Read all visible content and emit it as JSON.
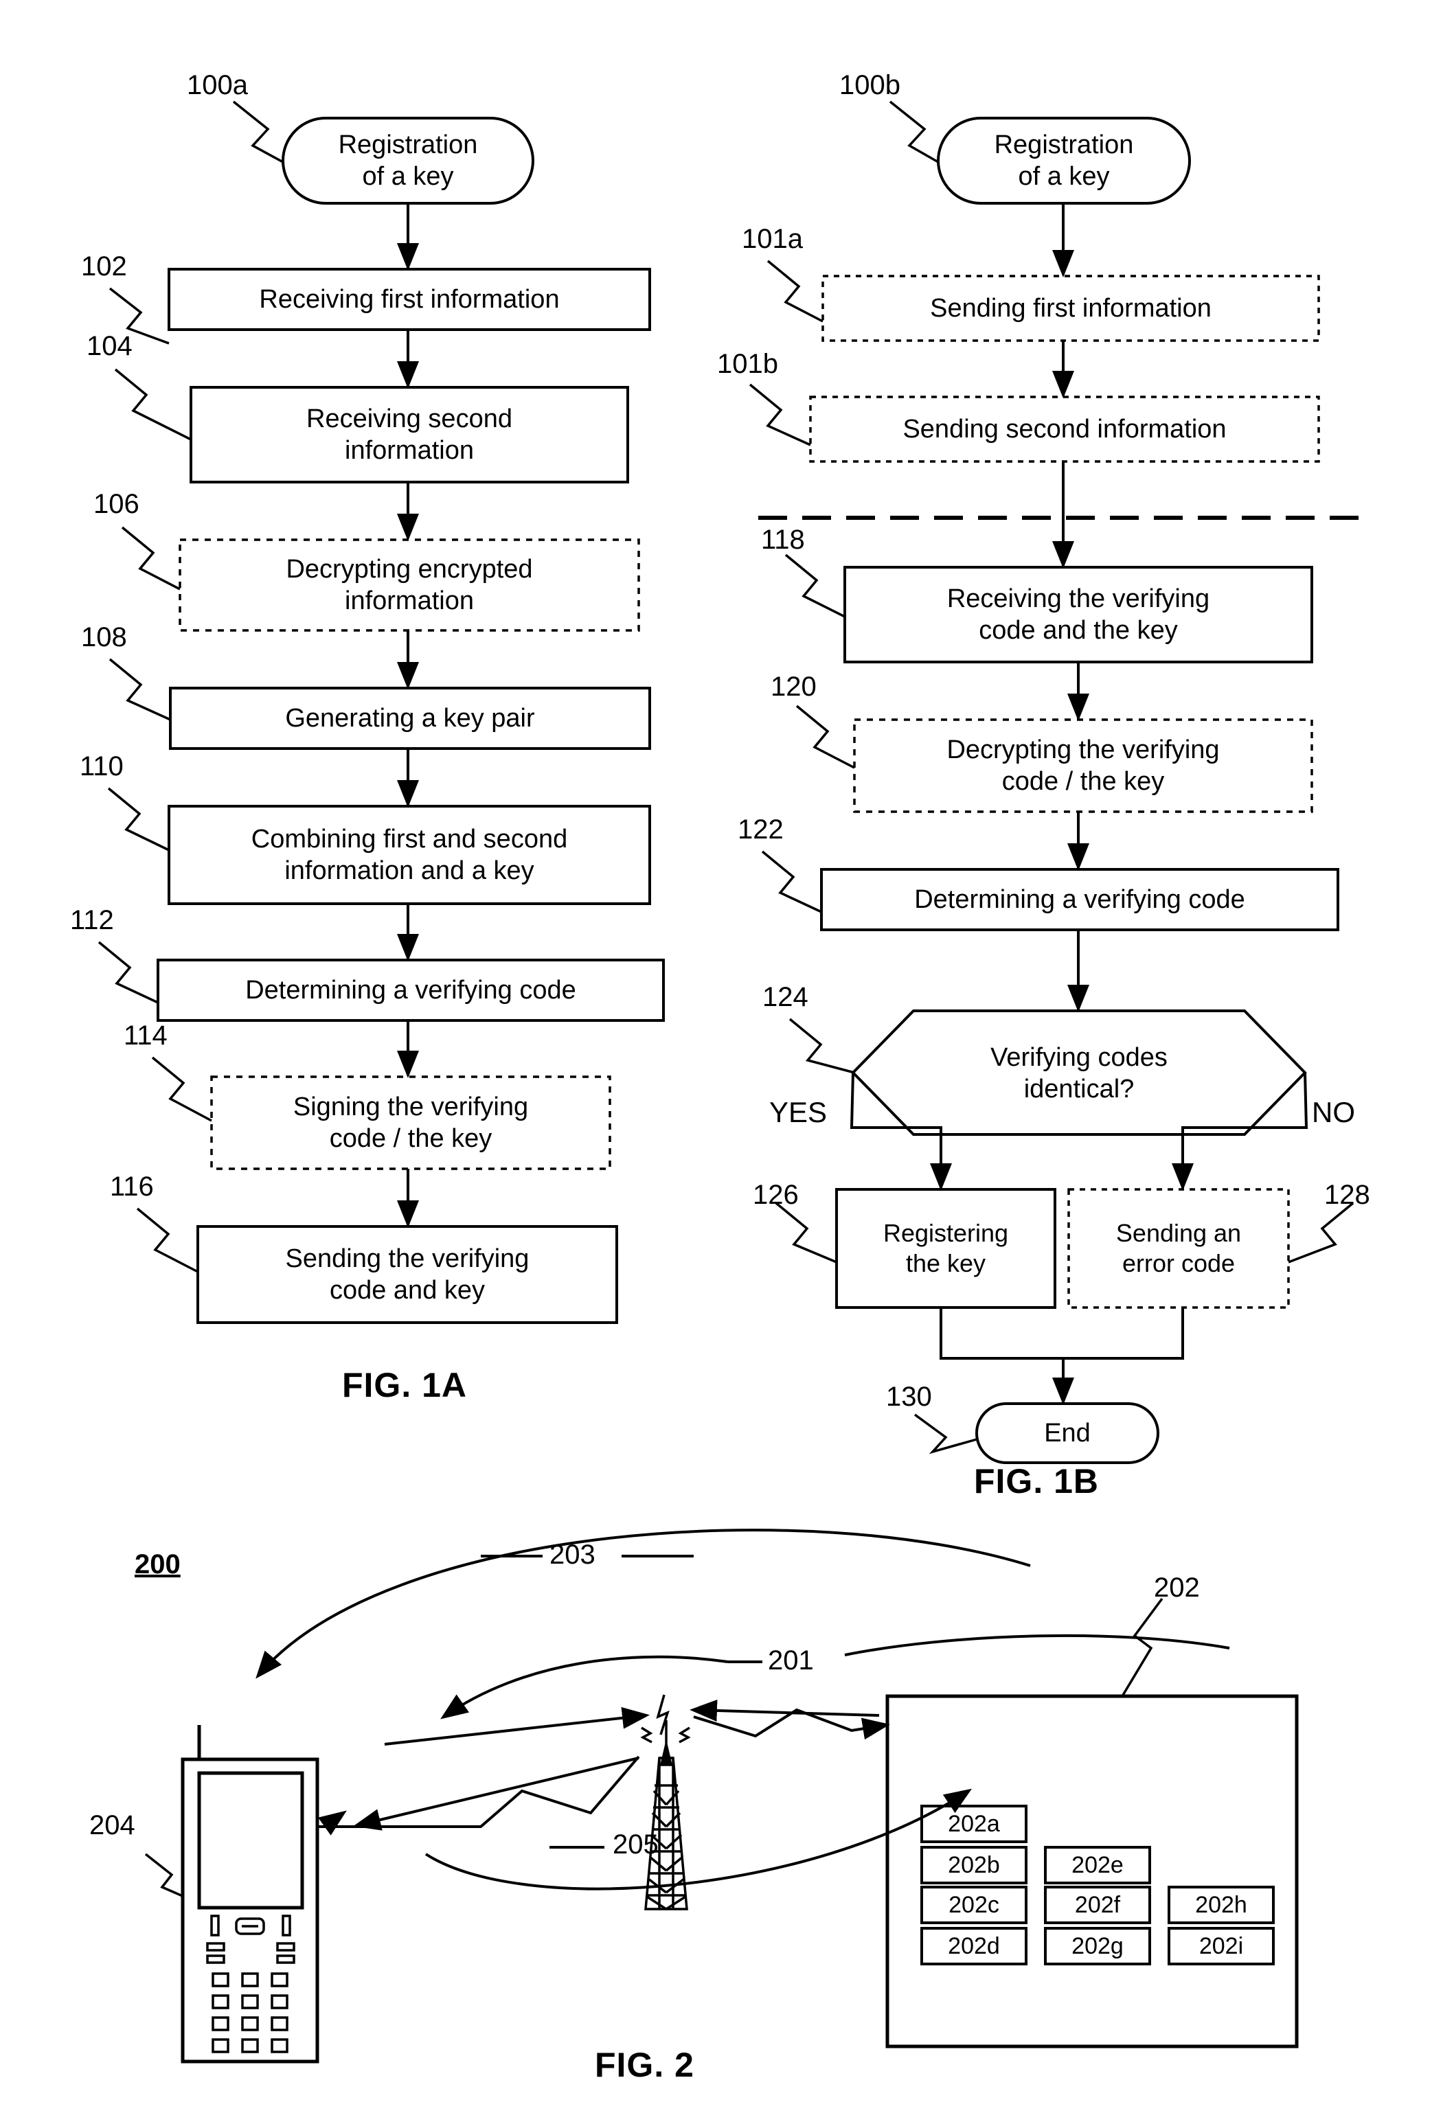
{
  "figures": [
    {
      "id": "fig1a",
      "caption": "FIG. 1A",
      "start_label": "100a",
      "start_text": "Registration\nof a key",
      "steps": [
        {
          "ref": "102",
          "text": "Receiving first information",
          "border": "solid"
        },
        {
          "ref": "104",
          "text": "Receiving second\ninformation",
          "border": "solid"
        },
        {
          "ref": "106",
          "text": "Decrypting encrypted\ninformation",
          "border": "dotted"
        },
        {
          "ref": "108",
          "text": "Generating a key pair",
          "border": "solid"
        },
        {
          "ref": "110",
          "text": "Combining first and second\ninformation and a key",
          "border": "solid"
        },
        {
          "ref": "112",
          "text": "Determining a verifying code",
          "border": "solid"
        },
        {
          "ref": "114",
          "text": "Signing the verifying\ncode / the key",
          "border": "dotted"
        },
        {
          "ref": "116",
          "text": "Sending the verifying\ncode and key",
          "border": "solid"
        }
      ]
    },
    {
      "id": "fig1b",
      "caption": "FIG. 1B",
      "start_label": "100b",
      "start_text": "Registration\nof a key",
      "steps": [
        {
          "ref": "101a",
          "text": "Sending first information",
          "border": "dotted"
        },
        {
          "ref": "101b",
          "text": "Sending second information",
          "border": "dotted"
        },
        {
          "ref": "118",
          "text": "Receiving the verifying\ncode and the key",
          "border": "solid"
        },
        {
          "ref": "120",
          "text": "Decrypting the verifying\ncode / the key",
          "border": "dotted"
        },
        {
          "ref": "122",
          "text": "Determining a verifying code",
          "border": "solid"
        }
      ],
      "decision": {
        "ref": "124",
        "text": "Verifying codes\nidentical?",
        "yes_label": "YES",
        "no_label": "NO"
      },
      "branches": [
        {
          "ref": "126",
          "text": "Registering\nthe key",
          "border": "solid"
        },
        {
          "ref": "128",
          "text": "Sending an\nerror code",
          "border": "dotted"
        }
      ],
      "end_ref": "130",
      "end_text": "End"
    },
    {
      "id": "fig2",
      "caption": "FIG. 2",
      "system_ref": "200",
      "device_ref": "204",
      "server_ref": "202",
      "tower_ref": "201",
      "link_refs": [
        "203",
        "205"
      ],
      "server_modules": [
        "202a",
        "202b",
        "202c",
        "202d",
        "202e",
        "202f",
        "202g",
        "202h",
        "202i"
      ]
    }
  ],
  "colors": {
    "ink": "#000000",
    "paper": "#ffffff"
  }
}
